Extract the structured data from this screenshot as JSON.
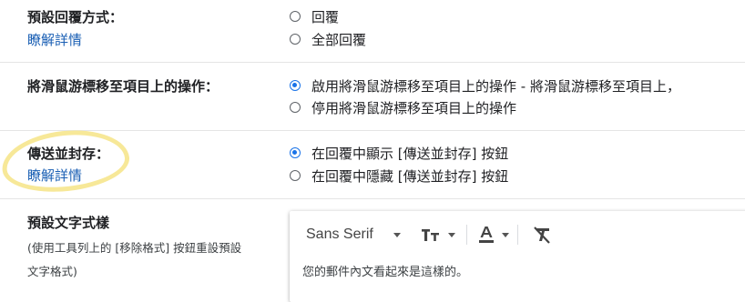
{
  "reply_behavior": {
    "label": "預設回覆方式：",
    "learn_more": "瞭解詳情",
    "options": [
      {
        "label": "回覆",
        "selected": false
      },
      {
        "label": "全部回覆",
        "selected": false
      }
    ]
  },
  "hover_actions": {
    "label": "將滑鼠游標移至項目上的操作：",
    "options": [
      {
        "label": "啟用將滑鼠游標移至項目上的操作 - 將滑鼠游標移至項目上，",
        "selected": true
      },
      {
        "label": "停用將滑鼠游標移至項目上的操作",
        "selected": false
      }
    ]
  },
  "send_and_archive": {
    "label": "傳送並封存：",
    "learn_more": "瞭解詳情",
    "options": [
      {
        "label": "在回覆中顯示 [傳送並封存] 按鈕",
        "selected": true
      },
      {
        "label": "在回覆中隱藏 [傳送並封存] 按鈕",
        "selected": false
      }
    ]
  },
  "default_text_style": {
    "label": "預設文字式樣",
    "help_line1": "(使用工具列上的 [移除格式] 按鈕重設預設",
    "help_line2": "文字格式)",
    "font": "Sans Serif",
    "preview": "您的郵件內文看起來是這樣的。"
  },
  "colors": {
    "link": "#1a5fb4",
    "radio_selected": "#1a73e8",
    "highlight": "#f6e58d"
  }
}
